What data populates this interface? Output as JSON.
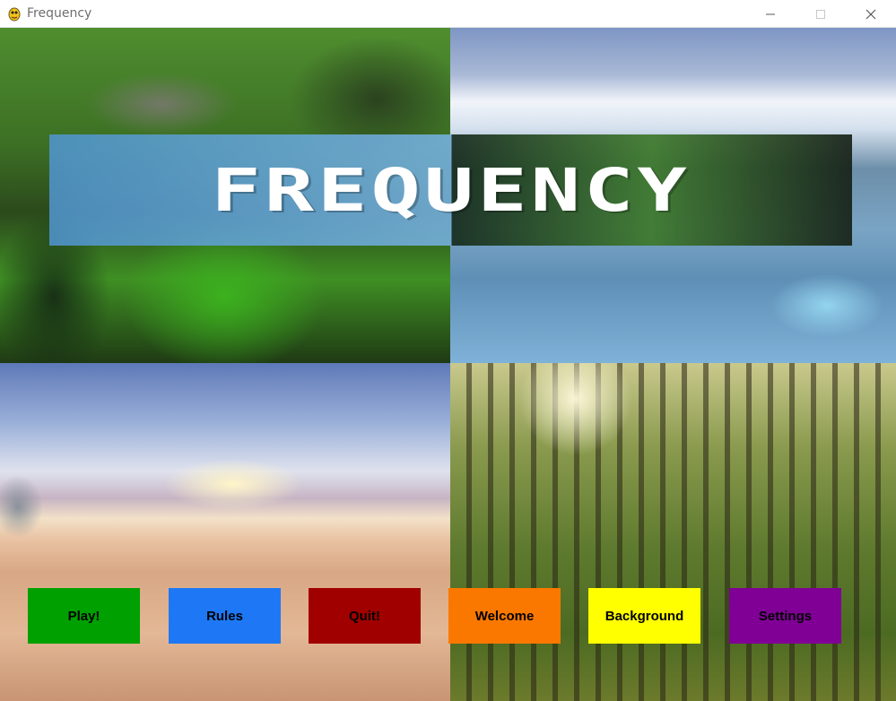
{
  "window": {
    "title": "Frequency",
    "icon": "pygame-snake-icon",
    "controls": [
      "minimize-icon",
      "maximize-icon",
      "close-icon"
    ]
  },
  "game": {
    "title": "FREQUENCY",
    "backgrounds": [
      "forest-lake",
      "glacier-ice",
      "desert-dunes",
      "sunlit-woods"
    ]
  },
  "menu": {
    "play": "Play!",
    "rules": "Rules",
    "quit": "Quit!",
    "welcome": "Welcome",
    "background": "Background",
    "settings": "Settings"
  },
  "colors": {
    "play": "#00a000",
    "rules": "#1e78f5",
    "quit": "#a00000",
    "welcome": "#fa7800",
    "background": "#ffff00",
    "settings": "#800096"
  }
}
